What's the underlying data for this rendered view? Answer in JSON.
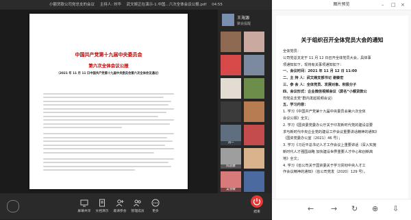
{
  "window": {
    "title": "小额贷款公司党总支的会议",
    "host": "主持人: 刘华",
    "sharing": "武文婉正在演示-1.中国...六次全体会议公报.pdf",
    "elapsed": "04:55"
  },
  "document": {
    "title1": "中国共产党第十九届中央委员会",
    "title2": "第六次全体会议公报",
    "subtitle": "（2021 年 11 月 11 日中国共产党第十九届中央委员会第六次全体会议通过）"
  },
  "sidebar": {
    "host_name": "王海源",
    "host_status": "聚会提醒",
    "participants": [
      {
        "label": ""
      },
      {
        "label": ""
      },
      {
        "label": ""
      },
      {
        "label": ""
      },
      {
        "label": ""
      },
      {
        "label": ""
      },
      {
        "label": ""
      },
      {
        "label": ""
      },
      {
        "label": "刘一"
      },
      {
        "label": ""
      },
      {
        "label": "陈迎康"
      },
      {
        "label": ""
      },
      {
        "label": "吴雪敏"
      },
      {
        "label": ""
      },
      {
        "label": ""
      },
      {
        "label": ""
      },
      {
        "label": "王晴"
      },
      {
        "label": ""
      },
      {
        "label": "王会龙"
      },
      {
        "label": ""
      },
      {
        "label": ""
      },
      {
        "label": ""
      },
      {
        "label": "华泰军"
      },
      {
        "label": ""
      }
    ]
  },
  "toolbar": {
    "items": [
      {
        "label": "屏幕共享",
        "icon": "screen-share-icon"
      },
      {
        "label": "文档演示",
        "icon": "document-icon"
      },
      {
        "label": "邀请参会",
        "icon": "invite-icon"
      },
      {
        "label": "管理成员",
        "icon": "members-icon"
      },
      {
        "label": "更多",
        "icon": "more-icon"
      }
    ],
    "leave_label": "结束",
    "leave_color": "#e53935"
  },
  "preview": {
    "window_title": "图片预览",
    "heading": "关于组织召开全体党员大会的通知",
    "lines": [
      {
        "text": "全体党员：",
        "bold": false
      },
      {
        "text": "    公司党总支定于 11 月 12 日召开全体党员大会，具体事",
        "bold": false
      },
      {
        "text": "项通知如下，现将有关事项通知如下：",
        "bold": false
      },
      {
        "text": "    一、会议时间：2021 年 11 月 12 日 11:00",
        "bold": true
      },
      {
        "text": "    二、主 持 人：武文婉支部书记   谢秦宏",
        "bold": true
      },
      {
        "text": "    三、参 会 人：全体党员、发展对象、积极分子",
        "bold": true
      },
      {
        "text": "    四、会议形式：企业微信视频会议（屏名“小额贷款公",
        "bold": true
      },
      {
        "text": "司党总支党”群内发起视频会议）",
        "bold": false
      },
      {
        "text": "    五、学习内容：",
        "bold": true
      },
      {
        "text": "    1. 学习《中国共产党第十九届中央委员会第六次全体",
        "bold": false
      },
      {
        "text": "会议公报》全文；",
        "bold": false
      },
      {
        "text": "    2. 学习《国资委党委办公厅关于印发新时代党的建设总要",
        "bold": false
      },
      {
        "text": "求与新时代中央企业党的建设工作会议重要讲话精神的通知》",
        "bold": false
      },
      {
        "text": "（国资党委办公室〔2021〕46 号）；",
        "bold": false
      },
      {
        "text": "    3. 学习《习近平总书记人才工作会议上重要讲话（深入实施",
        "bold": false
      },
      {
        "text": "新时代人才强国战略  加快建设世界重要人才中心和创新高",
        "bold": false
      },
      {
        "text": "地》全文；",
        "bold": false
      },
      {
        "text": "    4. 学习《省公司关于国资委关于学习贯彻中央人才工",
        "bold": false
      },
      {
        "text": "作会议精神的通知》（省公司党发〔2020〕129 号）。",
        "bold": false
      }
    ]
  }
}
